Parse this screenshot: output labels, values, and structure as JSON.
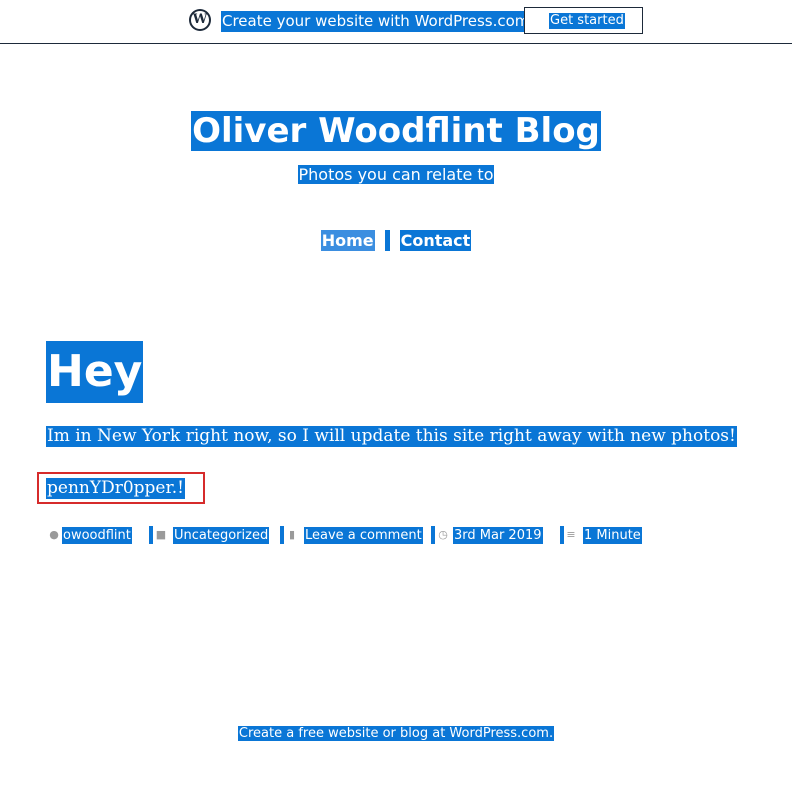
{
  "banner": {
    "text": "Create your website with WordPress.com",
    "button_label": "Get started",
    "logo_letter": "W"
  },
  "site": {
    "title": "Oliver Woodflint Blog",
    "tagline": "Photos you can relate to"
  },
  "nav": {
    "items": [
      {
        "label": "Home"
      },
      {
        "label": "Contact"
      }
    ]
  },
  "post": {
    "title": "Hey",
    "body": "Im in New York right now, so I will update this site right away with new photos!",
    "signature": "pennYDr0pper.!",
    "meta": {
      "author": "owoodflint",
      "category": "Uncategorized",
      "comments": "Leave a comment",
      "date": "3rd Mar 2019",
      "reading_time": "1 Minute"
    }
  },
  "footer": {
    "text": "Create a free website or blog at WordPress.com."
  },
  "colors": {
    "selection": "#0a76d6",
    "banner_dark": "#1d2a3a",
    "highlight_box": "#d62b2b"
  }
}
